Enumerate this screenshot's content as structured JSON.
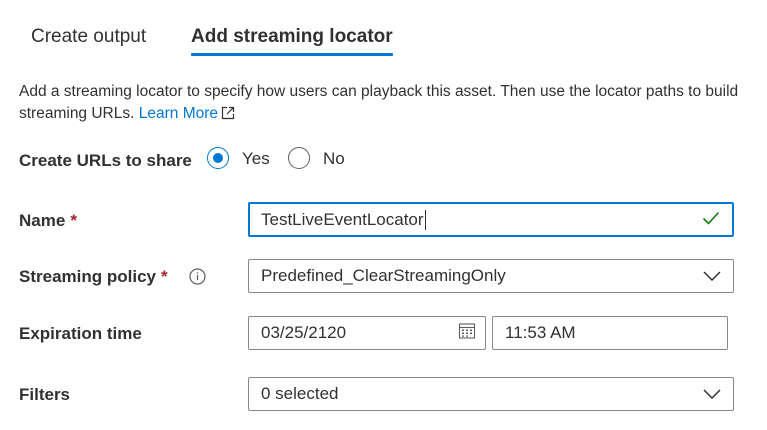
{
  "tabs": [
    {
      "label": "Create output"
    },
    {
      "label": "Add streaming locator",
      "active": true
    }
  ],
  "description": {
    "text": "Add a streaming locator to specify how users can playback this asset. Then use the locator paths to build streaming URLs.",
    "link_label": "Learn More",
    "link_icon": "external-link-icon"
  },
  "create_urls": {
    "label": "Create URLs to share",
    "options": [
      {
        "label": "Yes",
        "selected": true
      },
      {
        "label": "No",
        "selected": false
      }
    ]
  },
  "name": {
    "label": "Name",
    "required_marker": "*",
    "value": "TestLiveEventLocator",
    "valid_icon": "checkmark-icon"
  },
  "streaming_policy": {
    "label": "Streaming policy",
    "required_marker": "*",
    "info_icon": "info-icon",
    "value": "Predefined_ClearStreamingOnly"
  },
  "expiration": {
    "label": "Expiration time",
    "date": "03/25/2120",
    "date_icon": "calendar-icon",
    "time": "11:53 AM"
  },
  "filters": {
    "label": "Filters",
    "value": "0 selected"
  },
  "colors": {
    "accent": "#0078d4",
    "required": "#a4262c",
    "valid": "#107c10"
  }
}
